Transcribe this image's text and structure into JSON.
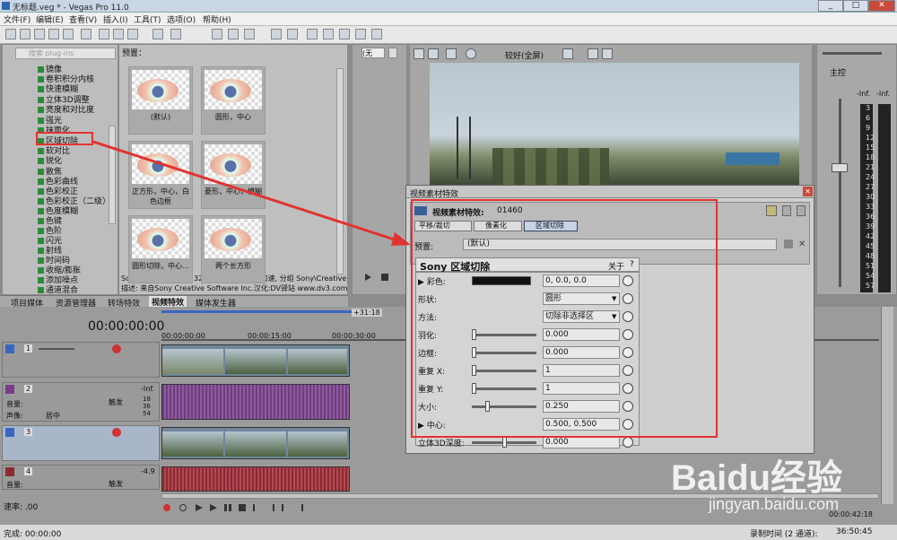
{
  "window": {
    "title": "无标题.veg * - Vegas Pro 11.0",
    "min": "_",
    "max": "□",
    "close": "✕"
  },
  "menu": [
    "文件(F)",
    "编辑(E)",
    "查看(V)",
    "插入(I)",
    "工具(T)",
    "选项(O)",
    "帮助(H)"
  ],
  "plugins": {
    "search_placeholder": "搜索 plug-ins",
    "items": [
      "镜像",
      "卷积积分内核",
      "快速模糊",
      "立体3D调整",
      "亮度和对比度",
      "强光",
      "抹面化",
      "区域切除",
      "软对比",
      "锐化",
      "散焦",
      "色彩曲线",
      "色彩校正",
      "色彩校正（二级）",
      "色度模糊",
      "色键",
      "色阶",
      "闪光",
      "射线",
      "时间码",
      "收缩/膨胀",
      "添加噪点",
      "通道混合"
    ],
    "highlighted": "区域切除"
  },
  "presets": {
    "header": "预置：",
    "items": [
      "(默认)",
      "圆形，中心",
      "正方形，中心，白色边框",
      "菱形，中心，模糊",
      "圆形切除，中心...",
      "两个长方形"
    ],
    "desc1": "Sony 区域切除: OFX, 32-bit 浮点型, GPU 加速, 分组 Sony\\Creative",
    "desc2": "描述: 来自Sony Creative Software Inc.汉化:DV驿站 www.dv3.com"
  },
  "bottom_tabs": [
    "项目媒体",
    "资源管理器",
    "转场特效",
    "视频特效",
    "媒体发生器"
  ],
  "preview": {
    "preset_select": "(无",
    "quality": "较好(全屏)"
  },
  "master": {
    "label": "主控",
    "inf_l": "-Inf.",
    "inf_r": "-Inf.",
    "scale": [
      "3",
      "6",
      "9",
      "12",
      "15",
      "18",
      "21",
      "24",
      "27",
      "30",
      "33",
      "36",
      "39",
      "42",
      "45",
      "48",
      "51",
      "54",
      "57"
    ]
  },
  "fx_dialog": {
    "title": "视频素材特效",
    "name_label": "视频素材特效:",
    "name_value": "01460",
    "chain": [
      "平移/裁切",
      "像素化",
      "区域切除"
    ],
    "preset_label": "预置:",
    "preset_value": "(默认)",
    "plugin_title": "Sony 区域切除",
    "about": "关于",
    "help": "?",
    "params": [
      {
        "label": "彩色:",
        "value": "0, 0.0, 0.0"
      },
      {
        "label": "形状:",
        "value": "圆形"
      },
      {
        "label": "方法:",
        "value": "切除非选择区"
      },
      {
        "label": "羽化:",
        "value": "0.000"
      },
      {
        "label": "边框:",
        "value": "0.000"
      },
      {
        "label": "重复 X:",
        "value": "1"
      },
      {
        "label": "重复 Y:",
        "value": "1"
      },
      {
        "label": "大小:",
        "value": "0.250"
      },
      {
        "label": "中心:",
        "value": "0.500, 0.500"
      },
      {
        "label": "立体3D深度:",
        "value": "0.000"
      }
    ]
  },
  "timeline": {
    "timecode": "00:00:00:00",
    "marks": [
      "00:00:00:00",
      "00:00:15:00",
      "00:00:30:00"
    ],
    "offset": "+31:18",
    "tracks": [
      {
        "num": "1"
      },
      {
        "num": "2",
        "vol": "音量:",
        "pan": "声像:",
        "pan_val": "居中",
        "fx": "触发",
        "inf": "-Inf."
      },
      {
        "num": "3"
      },
      {
        "num": "4",
        "vol": "音量:",
        "fx": "触发",
        "inf": "-4.9"
      }
    ],
    "rate": "速率: .00",
    "levels": [
      "18",
      "36",
      "54"
    ]
  },
  "status": {
    "left": "完成: 00:00:00",
    "mid_time": "00:00:42:18",
    "right_label": "录制时间 (2 通道):",
    "right_val": "36:50:45"
  },
  "watermark": {
    "brand": "Baidu经验",
    "url": "jingyan.baidu.com"
  }
}
